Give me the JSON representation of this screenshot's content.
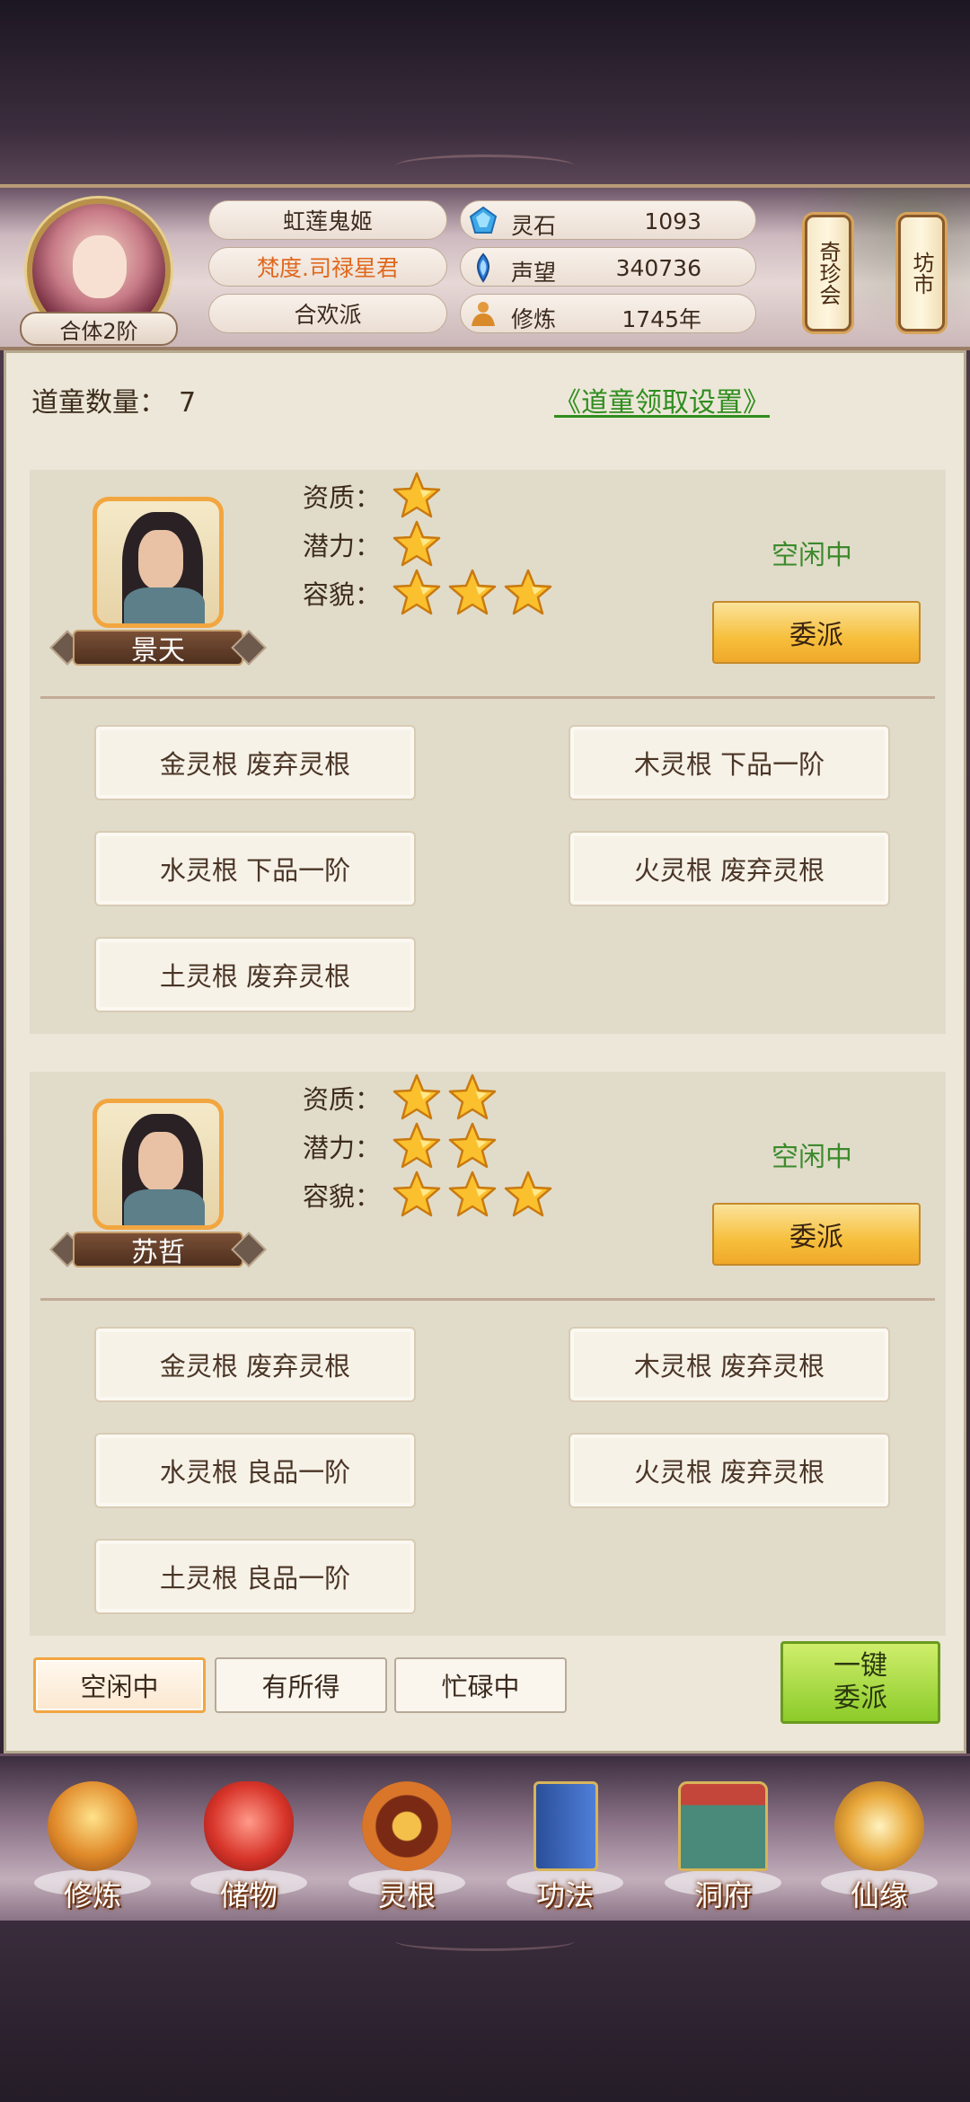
{
  "player": {
    "name": "虹莲鬼姬",
    "title": "梵度.司禄星君",
    "sect": "合欢派",
    "rank": "合体2阶"
  },
  "resources": [
    {
      "icon": "spirit-stone-icon",
      "label": "灵石",
      "value": "1093"
    },
    {
      "icon": "reputation-icon",
      "label": "声望",
      "value": "340736"
    },
    {
      "icon": "cultivation-icon",
      "label": "修炼",
      "value": "1745年"
    }
  ],
  "signs": [
    {
      "label": "奇珍会"
    },
    {
      "label": "坊市"
    }
  ],
  "apprentice_count_label": "道童数量：",
  "apprentice_count": "7",
  "settings_link": "《道童领取设置》",
  "attr_labels": {
    "aptitude": "资质：",
    "potential": "潜力：",
    "looks": "容貌："
  },
  "apprentices": [
    {
      "name": "景天",
      "aptitude": 1,
      "potential": 1,
      "looks": 3,
      "status": "空闲中",
      "assign_label": "委派",
      "roots": [
        "金灵根 废弃灵根",
        "木灵根 下品一阶",
        "水灵根 下品一阶",
        "火灵根 废弃灵根",
        "土灵根 废弃灵根"
      ]
    },
    {
      "name": "苏哲",
      "aptitude": 2,
      "potential": 2,
      "looks": 3,
      "status": "空闲中",
      "assign_label": "委派",
      "roots": [
        "金灵根 废弃灵根",
        "木灵根 废弃灵根",
        "水灵根 良品一阶",
        "火灵根 废弃灵根",
        "土灵根 良品一阶"
      ]
    }
  ],
  "filters": [
    "空闲中",
    "有所得",
    "忙碌中"
  ],
  "active_filter": "空闲中",
  "one_key": {
    "line1": "一键",
    "line2": "委派"
  },
  "nav": [
    {
      "label": "修炼",
      "icon": "cultivate-icon"
    },
    {
      "label": "储物",
      "icon": "storage-bag-icon"
    },
    {
      "label": "灵根",
      "icon": "spirit-root-icon"
    },
    {
      "label": "功法",
      "icon": "technique-book-icon"
    },
    {
      "label": "洞府",
      "icon": "cave-mansion-icon"
    },
    {
      "label": "仙缘",
      "icon": "immortal-fate-icon"
    }
  ],
  "colors": {
    "accent_green": "#3c8a2c",
    "link_green": "#2f8d1e",
    "highlight_orange": "#f2a640",
    "title_orange": "#e0671c"
  }
}
